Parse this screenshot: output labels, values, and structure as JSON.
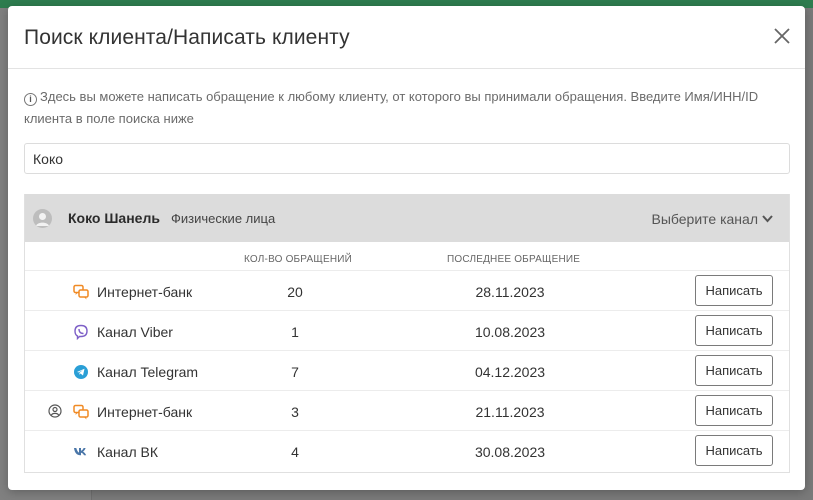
{
  "modal": {
    "title": "Поиск клиента/Написать клиенту",
    "info_text": "Здесь вы можете написать обращение к любому клиенту, от которого вы принимали обращения. Введите Имя/ИНН/ID клиента в поле поиска ниже",
    "search_value": "Коко"
  },
  "client": {
    "name": "Коко Шанель",
    "type": "Физические лица",
    "channel_select": "Выберите канал"
  },
  "columns": {
    "count": "Кол-во обращений",
    "last": "Последнее обращение"
  },
  "rows": [
    {
      "channel": "Интернет-банк",
      "icon": "chat-bubbles-icon",
      "count": "20",
      "date": "28.11.2023",
      "button": "Написать",
      "user_icon": false
    },
    {
      "channel": "Канал Viber",
      "icon": "viber-icon",
      "count": "1",
      "date": "10.08.2023",
      "button": "Написать",
      "user_icon": false
    },
    {
      "channel": "Канал Telegram",
      "icon": "telegram-icon",
      "count": "7",
      "date": "04.12.2023",
      "button": "Написать",
      "user_icon": false
    },
    {
      "channel": "Интернет-банк",
      "icon": "chat-bubbles-icon",
      "count": "3",
      "date": "21.11.2023",
      "button": "Написать",
      "user_icon": true
    },
    {
      "channel": "Канал ВК",
      "icon": "vk-icon",
      "count": "4",
      "date": "30.08.2023",
      "button": "Написать",
      "user_icon": false
    }
  ],
  "colors": {
    "internet_bank": "#f08a24",
    "viber": "#7d5fc7",
    "telegram": "#2a9fd6",
    "vk": "#4a76a8",
    "header_bg": "#dcdcdc"
  }
}
